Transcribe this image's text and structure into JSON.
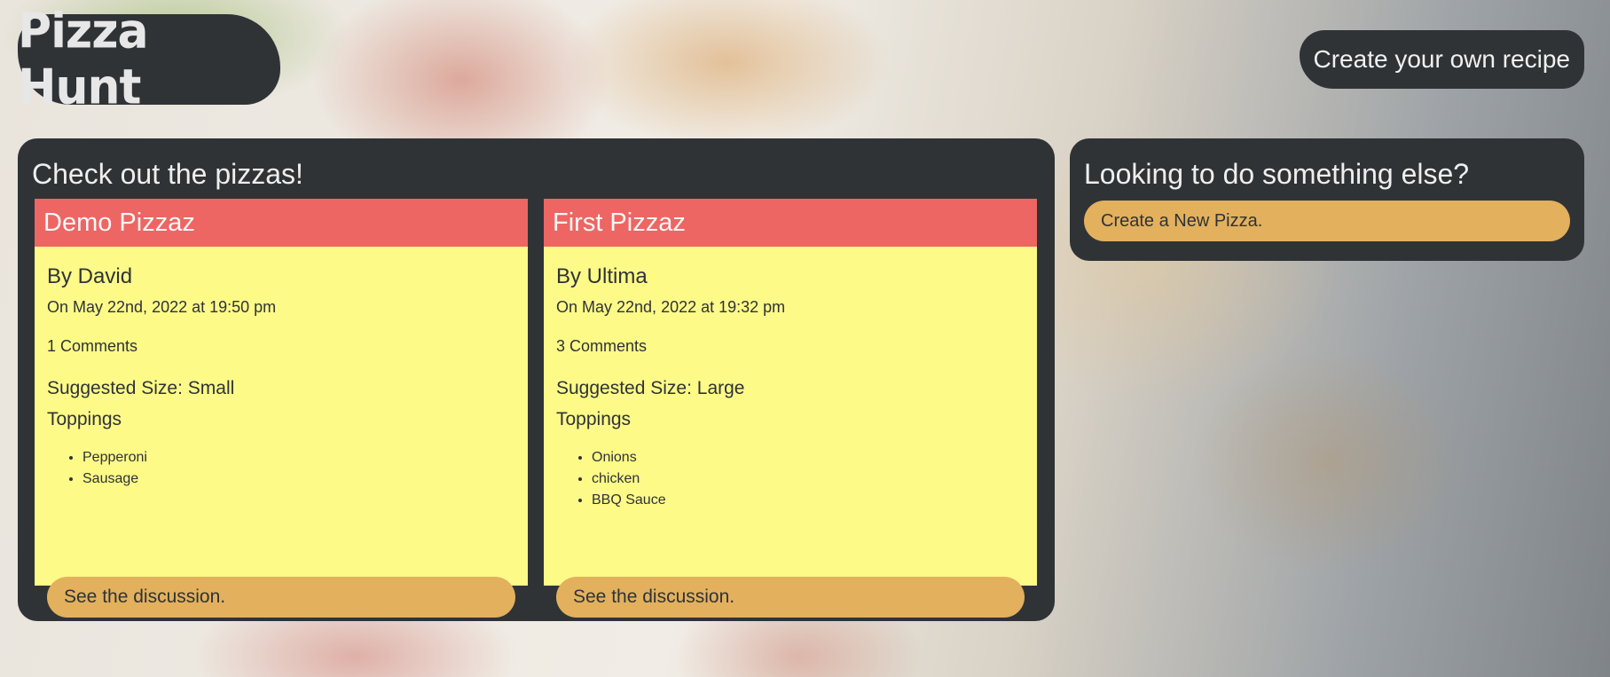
{
  "header": {
    "logo_text": "Pizza Hunt",
    "create_recipe_label": "Create your own recipe"
  },
  "pizzas_panel": {
    "title": "Check out the pizzas!",
    "cards": [
      {
        "name": "Demo Pizzaz",
        "author": "By David",
        "date": "On May 22nd, 2022 at 19:50 pm",
        "comments": "1 Comments",
        "size": "Suggested Size: Small",
        "toppings_label": "Toppings",
        "toppings": [
          "Pepperoni",
          "Sausage"
        ],
        "discussion_label": "See the discussion."
      },
      {
        "name": "First Pizzaz",
        "author": "By Ultima",
        "date": "On May 22nd, 2022 at 19:32 pm",
        "comments": "3 Comments",
        "size": "Suggested Size: Large",
        "toppings_label": "Toppings",
        "toppings": [
          "Onions",
          "chicken",
          "BBQ Sauce"
        ],
        "discussion_label": "See the discussion."
      }
    ]
  },
  "else_panel": {
    "title": "Looking to do something else?",
    "new_pizza_label": "Create a New Pizza."
  },
  "colors": {
    "panel": "#2f3336",
    "card_header": "#ed6663",
    "card_body": "#fdfa88",
    "button": "#e3b05d"
  }
}
